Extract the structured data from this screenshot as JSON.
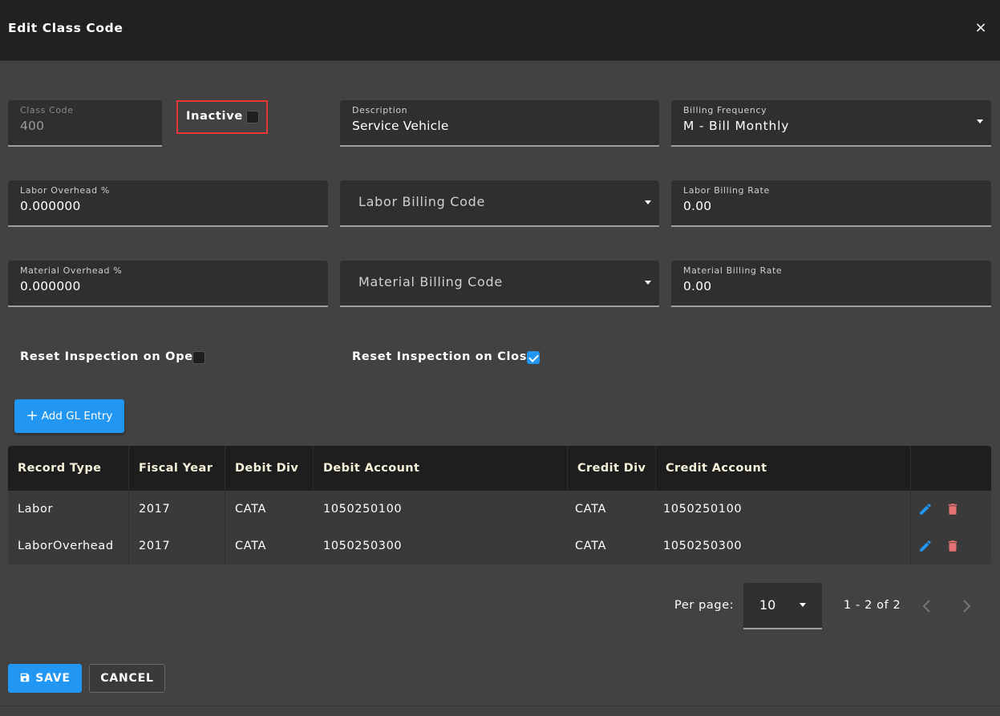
{
  "dialog": {
    "title": "Edit Class Code",
    "close_label": "×"
  },
  "form": {
    "class_code": {
      "label": "Class Code",
      "value": "400"
    },
    "inactive": {
      "label": "Inactive",
      "checked": false
    },
    "description": {
      "label": "Description",
      "value": "Service Vehicle"
    },
    "billing_frequency": {
      "label": "Billing Frequency",
      "value": "M - Bill Monthly"
    },
    "labor_overhead": {
      "label": "Labor Overhead %",
      "value": "0.000000"
    },
    "labor_billing_code": {
      "placeholder": "Labor Billing Code"
    },
    "labor_billing_rate": {
      "label": "Labor Billing Rate",
      "value": "0.00"
    },
    "material_overhead": {
      "label": "Material Overhead %",
      "value": "0.000000"
    },
    "material_billing_code": {
      "placeholder": "Material Billing Code"
    },
    "material_billing_rate": {
      "label": "Material Billing Rate",
      "value": "0.00"
    },
    "reset_on_open": {
      "label": "Reset Inspection on Open",
      "checked": false
    },
    "reset_on_close": {
      "label": "Reset Inspection on Close",
      "checked": true
    }
  },
  "add_gl_button": {
    "icon": "plus-icon",
    "label": "Add GL Entry"
  },
  "table": {
    "headers": [
      "Record Type",
      "Fiscal Year",
      "Debit Div",
      "Debit Account",
      "Credit Div",
      "Credit Account"
    ],
    "rows": [
      [
        "Labor",
        "2017",
        "CATA",
        "1050250100",
        "CATA",
        "1050250100"
      ],
      [
        "LaborOverhead",
        "2017",
        "CATA",
        "1050250300",
        "CATA",
        "1050250300"
      ]
    ],
    "row_actions": [
      "pencil-icon",
      "trash-icon"
    ]
  },
  "pagination": {
    "per_page_label": "Per page:",
    "per_page_value": "10",
    "range": "1 - 2 of 2"
  },
  "actions": {
    "save_label": "SAVE",
    "cancel_label": "CANCEL",
    "save_icon": "floppy-disk-icon"
  },
  "colors": {
    "accent": "#2196f3",
    "highlight_border": "#e53935",
    "delete": "#e57373",
    "header_text": "#f5f0d8"
  }
}
